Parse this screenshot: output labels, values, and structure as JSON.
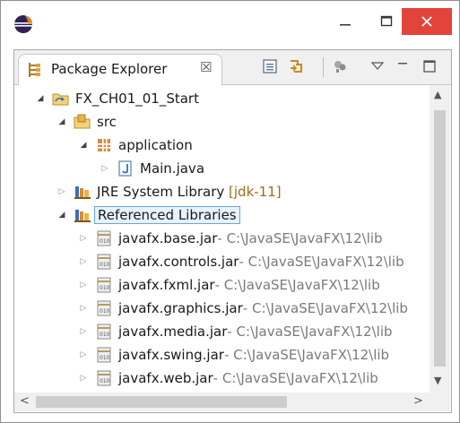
{
  "window": {
    "controls": {
      "minimize_icon": "minimize-icon",
      "maximize_icon": "maximize-icon",
      "close_icon": "close-icon",
      "close_color": "#e2443b"
    }
  },
  "view": {
    "tab_label": "Package Explorer",
    "tab_close_glyph": "☒",
    "toolbar_icons": [
      "collapse-all-icon",
      "link-with-editor-icon",
      "filters-icon",
      "view-menu-icon",
      "minimize-view-icon",
      "maximize-view-icon"
    ]
  },
  "tree": {
    "project": "FX_CH01_01_Start",
    "src": "src",
    "package": "application",
    "main_file": "Main.java",
    "jre": {
      "label": "JRE System Library",
      "suffix": "[jdk-11]"
    },
    "referenced": "Referenced Libraries",
    "jars": [
      {
        "name": "javafx.base.jar",
        "path": " - C:\\JavaSE\\JavaFX\\12\\lib"
      },
      {
        "name": "javafx.controls.jar",
        "path": " - C:\\JavaSE\\JavaFX\\12\\lib"
      },
      {
        "name": "javafx.fxml.jar",
        "path": " - C:\\JavaSE\\JavaFX\\12\\lib"
      },
      {
        "name": "javafx.graphics.jar",
        "path": " - C:\\JavaSE\\JavaFX\\12\\lib"
      },
      {
        "name": "javafx.media.jar",
        "path": " - C:\\JavaSE\\JavaFX\\12\\lib"
      },
      {
        "name": "javafx.swing.jar",
        "path": " - C:\\JavaSE\\JavaFX\\12\\lib"
      },
      {
        "name": "javafx.web.jar",
        "path": " - C:\\JavaSE\\JavaFX\\12\\lib"
      }
    ]
  }
}
